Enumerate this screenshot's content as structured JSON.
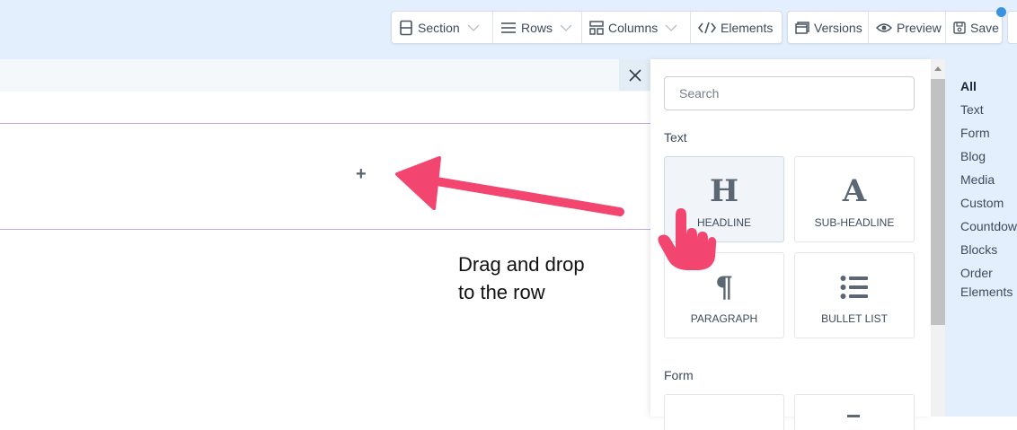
{
  "toolbar": {
    "layout_group": [
      {
        "label": "Section",
        "icon": "section-icon",
        "dropdown": true
      },
      {
        "label": "Rows",
        "icon": "rows-icon",
        "dropdown": true
      },
      {
        "label": "Columns",
        "icon": "columns-icon",
        "dropdown": true
      },
      {
        "label": "Elements",
        "icon": "code-icon",
        "dropdown": false
      }
    ],
    "actions_group": [
      {
        "label": "Versions",
        "icon": "versions-icon"
      },
      {
        "label": "Preview",
        "icon": "eye-icon"
      },
      {
        "label": "Save",
        "icon": "save-icon"
      }
    ],
    "notification_color": "#3b93e0"
  },
  "canvas": {
    "add_button": "+",
    "hint_line1": "Drag and drop",
    "hint_line2": "to the row",
    "row_border_color": "#c7a6e0",
    "arrow_color": "#f2456f"
  },
  "panel": {
    "search_placeholder": "Search",
    "sections": [
      {
        "title": "Text",
        "elements": [
          {
            "label": "HEADLINE",
            "icon": "headline-icon",
            "glyph": "H",
            "hovered": true
          },
          {
            "label": "SUB-HEADLINE",
            "icon": "sub-headline-icon",
            "glyph": "A"
          },
          {
            "label": "PARAGRAPH",
            "icon": "paragraph-icon",
            "glyph": "¶"
          },
          {
            "label": "BULLET LIST",
            "icon": "bullet-list-icon"
          }
        ]
      },
      {
        "title": "Form",
        "elements": []
      }
    ]
  },
  "categories": [
    {
      "label": "All",
      "selected": true
    },
    {
      "label": "Text"
    },
    {
      "label": "Form"
    },
    {
      "label": "Blog"
    },
    {
      "label": "Media"
    },
    {
      "label": "Custom"
    },
    {
      "label": "Countdown"
    },
    {
      "label": "Blocks"
    },
    {
      "label": "Order Elements"
    }
  ]
}
